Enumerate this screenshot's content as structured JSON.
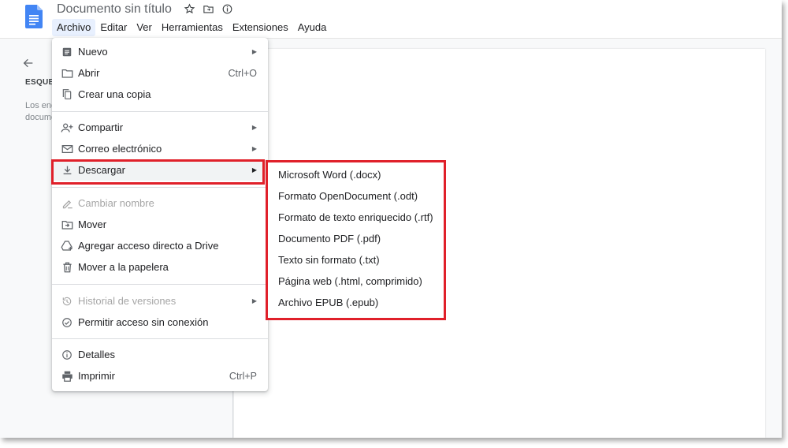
{
  "header": {
    "title": "Documento sin título",
    "star_icon": "star-icon",
    "folder_icon": "move-to-folder-icon",
    "status_icon": "document-status-icon"
  },
  "menubar": [
    "Archivo",
    "Editar",
    "Ver",
    "Herramientas",
    "Extensiones",
    "Ayuda"
  ],
  "outline": {
    "heading": "ESQUEMA",
    "text_line1": "Los encabezados que añadas al",
    "text_line2": "documento aparecerán aquí."
  },
  "file_menu": {
    "items": [
      {
        "label": "Nuevo",
        "icon": "new-document-icon",
        "submenu": true
      },
      {
        "label": "Abrir",
        "icon": "folder-icon",
        "shortcut": "Ctrl+O"
      },
      {
        "label": "Crear una copia",
        "icon": "copy-icon"
      },
      {
        "label": "Compartir",
        "icon": "share-person-icon",
        "submenu": true
      },
      {
        "label": "Correo electrónico",
        "icon": "email-icon",
        "submenu": true
      },
      {
        "label": "Descargar",
        "icon": "download-icon",
        "submenu": true,
        "highlighted": true
      },
      {
        "label": "Cambiar nombre",
        "icon": "rename-icon",
        "disabled": true
      },
      {
        "label": "Mover",
        "icon": "move-folder-icon"
      },
      {
        "label": "Agregar acceso directo a Drive",
        "icon": "drive-shortcut-icon"
      },
      {
        "label": "Mover a la papelera",
        "icon": "trash-icon"
      },
      {
        "label": "Historial de versiones",
        "icon": "history-icon",
        "submenu": true,
        "disabled": true
      },
      {
        "label": "Permitir acceso sin conexión",
        "icon": "offline-check-icon"
      },
      {
        "label": "Detalles",
        "icon": "info-icon"
      },
      {
        "label": "Imprimir",
        "icon": "print-icon",
        "shortcut": "Ctrl+P"
      }
    ]
  },
  "download_submenu": {
    "items": [
      "Microsoft Word (.docx)",
      "Formato OpenDocument (.odt)",
      "Formato de texto enriquecido (.rtf)",
      "Documento PDF (.pdf)",
      "Texto sin formato (.txt)",
      "Página web (.html, comprimido)",
      "Archivo EPUB (.epub)"
    ]
  },
  "colors": {
    "highlight_border": "#e0202a",
    "docs_blue": "#4285f4"
  }
}
